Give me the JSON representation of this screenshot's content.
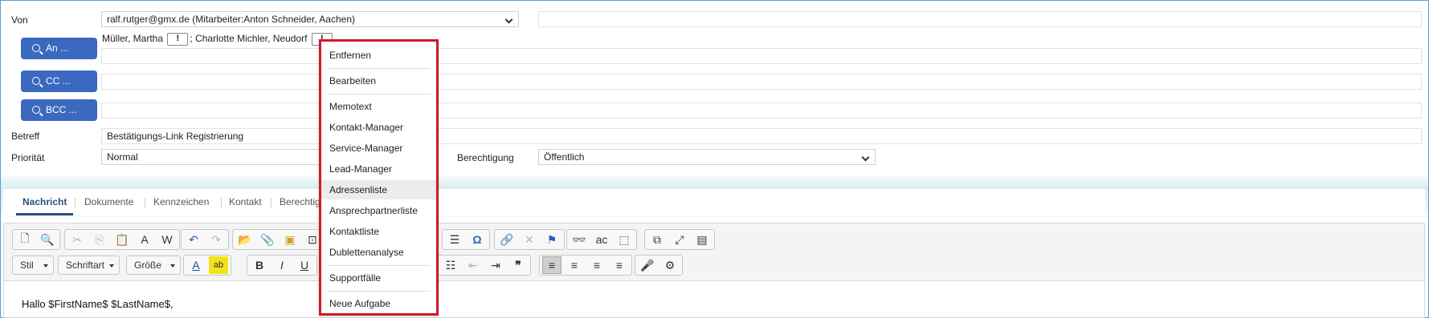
{
  "form": {
    "from_label": "Von",
    "from_value": "ralf.rutger@gmx.de (Mitarbeiter:Anton Schneider, Aachen)",
    "to_button": "An ...",
    "cc_button": "CC ...",
    "bcc_button": "BCC ...",
    "recipients": [
      {
        "name": "Müller, Martha",
        "marker": "!"
      },
      {
        "name": "Charlotte Michler, Neudorf",
        "marker": "!"
      }
    ],
    "recipient_separator": ";",
    "subject_label": "Betreff",
    "subject_value": "Bestätigungs-Link Registrierung",
    "priority_label": "Priorität",
    "priority_value": "Normal",
    "permission_label": "Berechtigung",
    "permission_value": "Öffentlich"
  },
  "tabs": [
    "Nachricht",
    "Dokumente",
    "Kennzeichen",
    "Kontakt",
    "Berechtig"
  ],
  "toolbar": {
    "style_label": "Stil",
    "font_label": "Schriftart",
    "size_label": "Größe",
    "bold": "B",
    "italic": "I",
    "underline": "U",
    "omega": "Ω"
  },
  "editor": {
    "body_text": "Hallo $FirstName$ $LastName$,"
  },
  "context_menu": {
    "items": [
      "Entfernen",
      "Bearbeiten",
      "Memotext",
      "Kontakt-Manager",
      "Service-Manager",
      "Lead-Manager",
      "Adressenliste",
      "Ansprechpartnerliste",
      "Kontaktliste",
      "Dublettenanalyse",
      "Supportfälle",
      "Neue Aufgabe"
    ],
    "highlighted": "Adressenliste"
  },
  "colors": {
    "button_blue": "#3b69bf",
    "menu_border": "#d3182a",
    "active_tab": "#2a4f7a"
  }
}
